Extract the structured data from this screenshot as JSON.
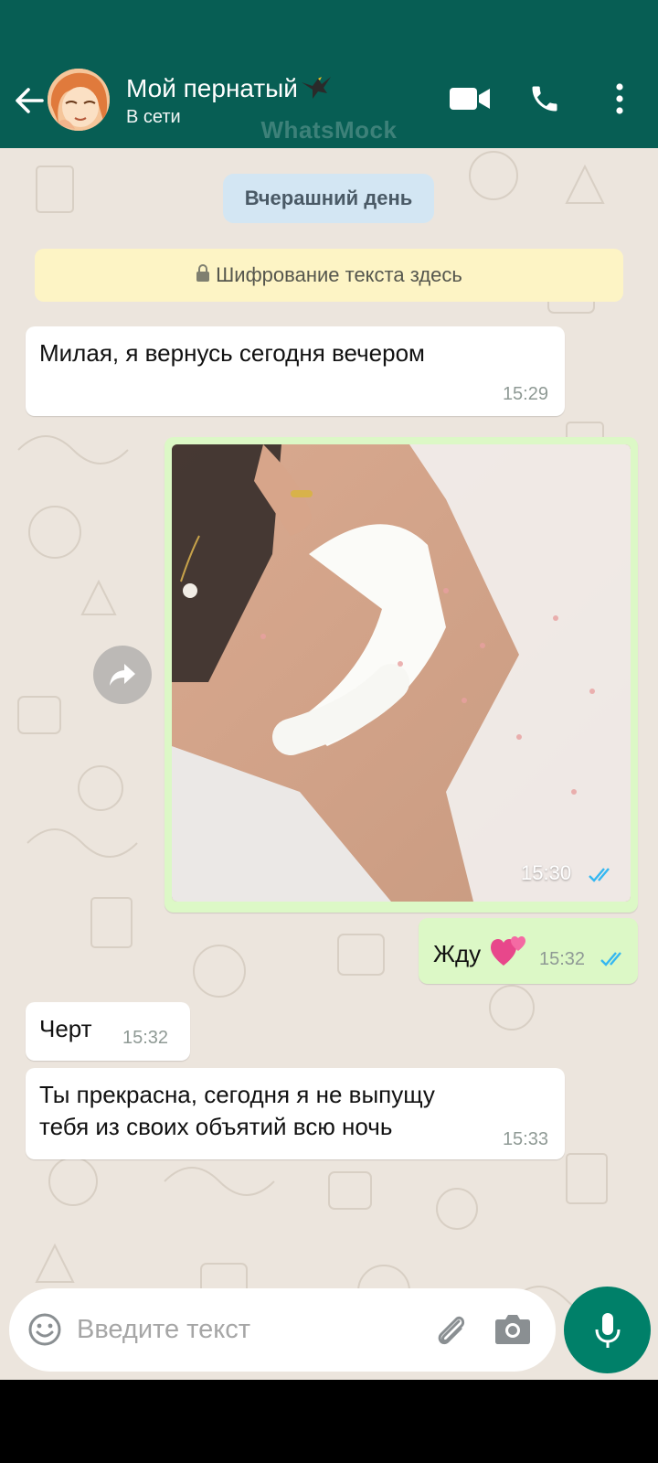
{
  "header": {
    "contact_name": "Мой пернатый",
    "status": "В сети",
    "watermark": "WhatsMock",
    "icons": [
      "back-arrow-icon",
      "eagle-emoji-icon",
      "video-camera-icon",
      "phone-icon",
      "more-vert-icon"
    ]
  },
  "chat": {
    "date_label": "Вчерашний день",
    "encryption_notice": "Шифрование текста здесь",
    "messages": [
      {
        "direction": "incoming",
        "text": "Милая, я вернусь сегодня вечером",
        "time": "15:29"
      },
      {
        "direction": "outgoing",
        "type": "image",
        "image_description": "photo",
        "time": "15:30",
        "read": true
      },
      {
        "direction": "outgoing",
        "text": "Жду",
        "emoji": "two-hearts",
        "time": "15:32",
        "read": true
      },
      {
        "direction": "incoming",
        "text": "Черт",
        "time": "15:32"
      },
      {
        "direction": "incoming",
        "text_lines": [
          "Ты прекрасна, сегодня я не выпущу",
          "тебя из своих объятий всю ночь"
        ],
        "time": "15:33"
      }
    ]
  },
  "composer": {
    "placeholder": "Введите текст",
    "icons": [
      "emoji-icon",
      "attach-icon",
      "camera-icon",
      "mic-icon"
    ]
  },
  "colors": {
    "header_bg": "#075e54",
    "chat_bg": "#ece5dd",
    "outgoing_bubble": "#dcf8c6",
    "incoming_bubble": "#ffffff",
    "read_ticks": "#34b7f1",
    "mic_button": "#008069"
  }
}
